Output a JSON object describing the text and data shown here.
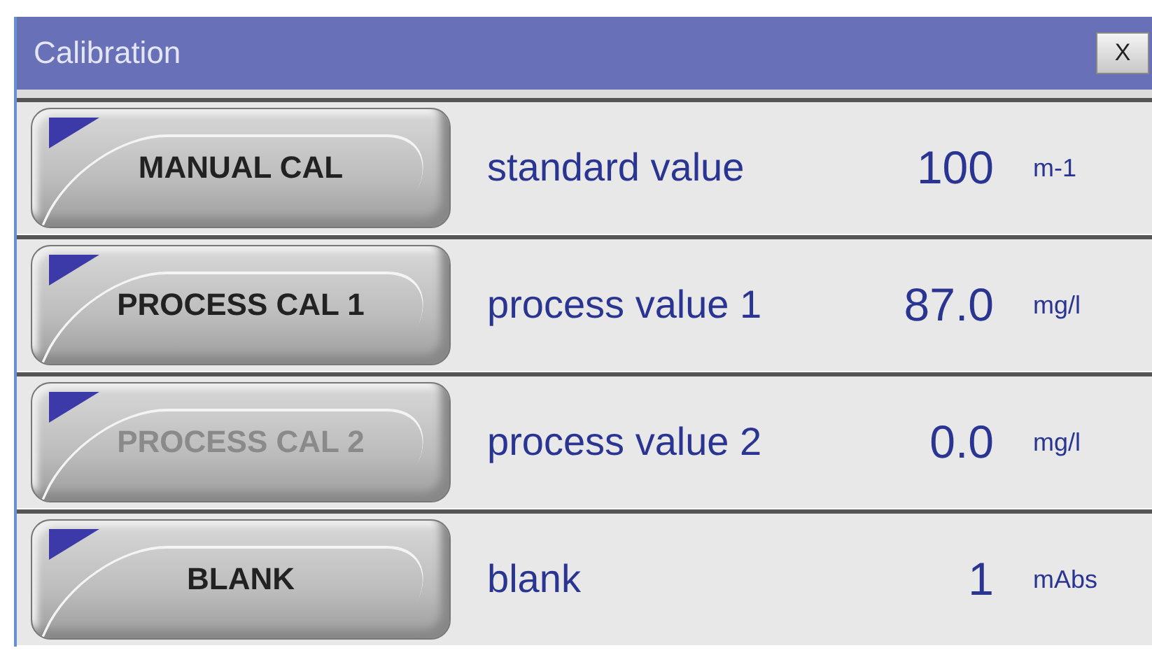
{
  "window": {
    "title": "Calibration",
    "close": "X"
  },
  "rows": [
    {
      "button": "MANUAL CAL",
      "disabled": false,
      "label": "standard value",
      "value": "100",
      "unit": "m-1"
    },
    {
      "button": "PROCESS CAL 1",
      "disabled": false,
      "label": "process value 1",
      "value": "87.0",
      "unit": "mg/l"
    },
    {
      "button": "PROCESS CAL 2",
      "disabled": true,
      "label": "process value 2",
      "value": "0.0",
      "unit": "mg/l"
    },
    {
      "button": "BLANK",
      "disabled": false,
      "label": "blank",
      "value": "1",
      "unit": "mAbs"
    }
  ]
}
